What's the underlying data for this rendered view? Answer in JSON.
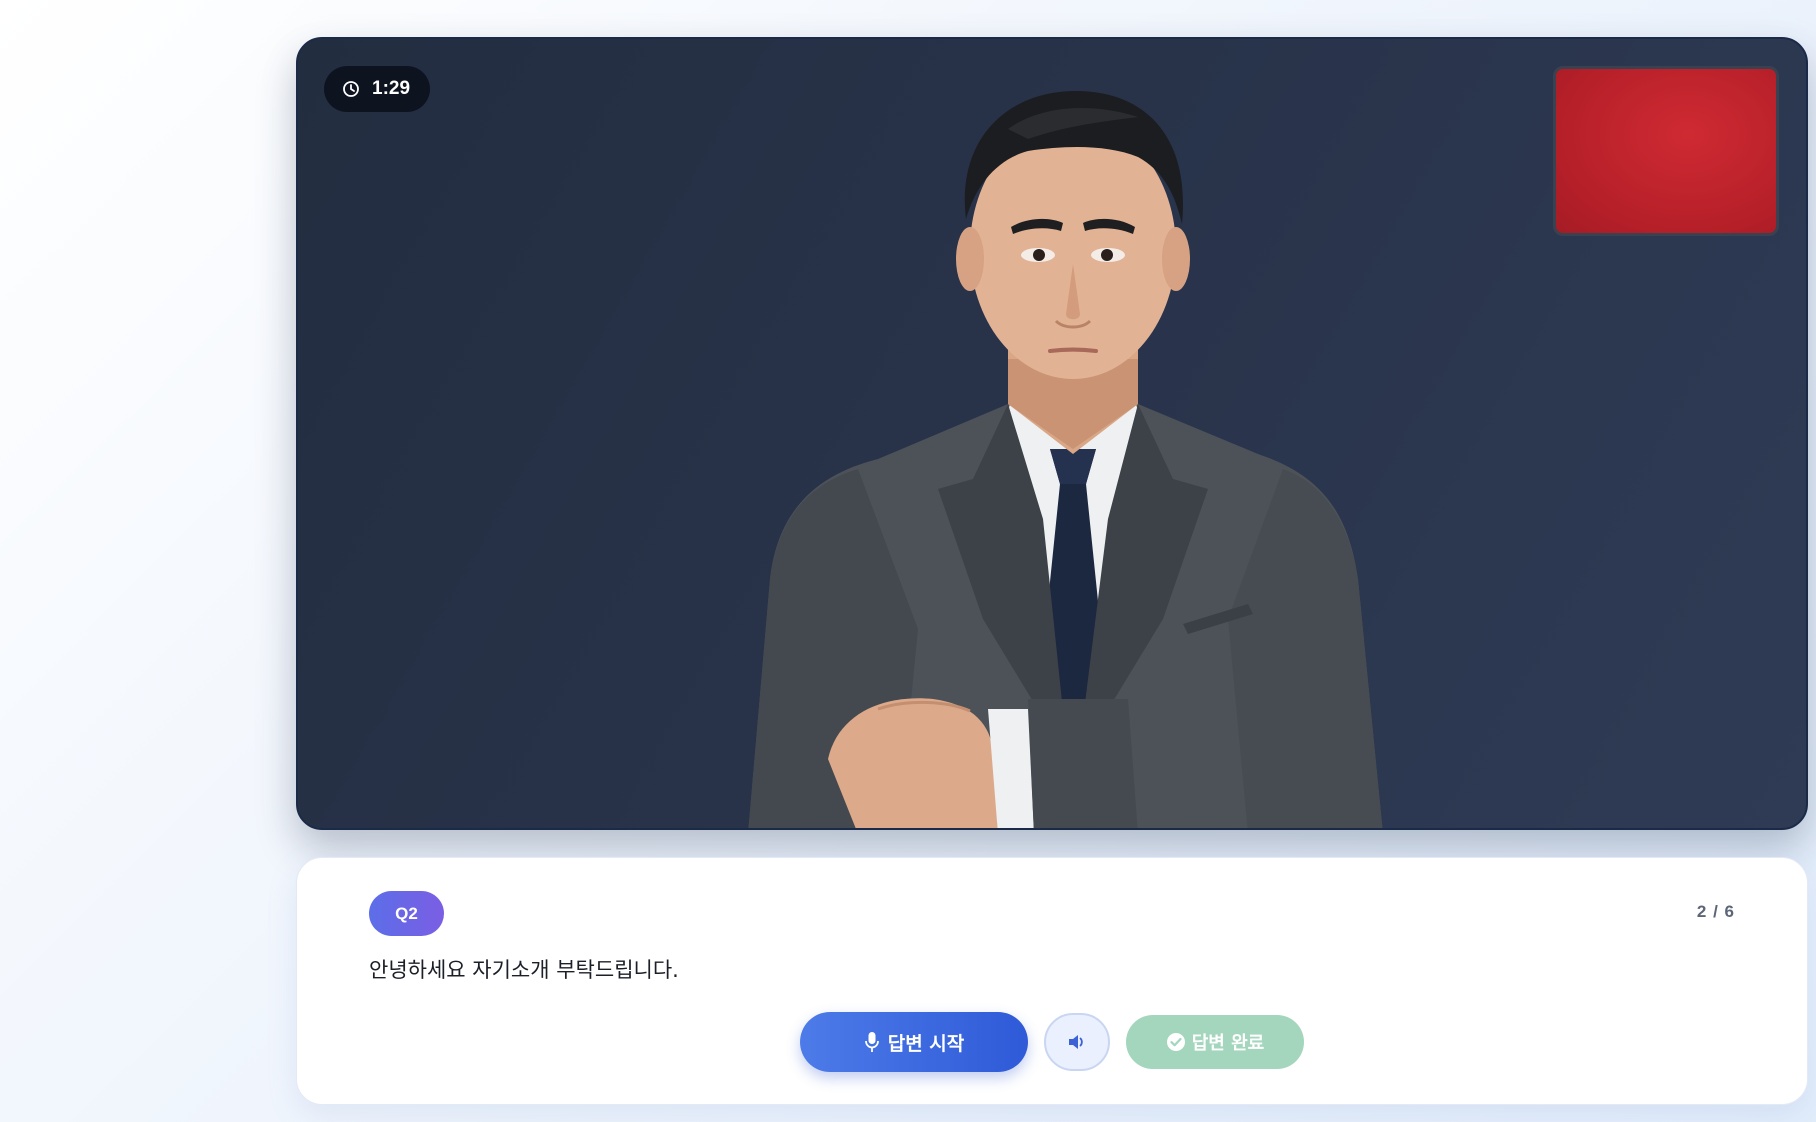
{
  "stage": {
    "timer": {
      "icon": "clock-icon",
      "value": "1:29"
    },
    "self_view": {
      "color": "#c1242d"
    },
    "background_color": "#28334a"
  },
  "question": {
    "badge": "Q2",
    "progress": "2 / 6",
    "text": "안녕하세요 자기소개 부탁드립니다."
  },
  "controls": {
    "start": {
      "icon": "microphone-icon",
      "label": "답변 시작",
      "color": "#3a66de"
    },
    "speaker": {
      "icon": "speaker-icon"
    },
    "complete": {
      "icon": "check-circle-icon",
      "label": "답변 완료",
      "color": "#a3d6bd"
    }
  },
  "colors": {
    "accent": "#5c6ee8",
    "card_background": "#ffffff"
  }
}
